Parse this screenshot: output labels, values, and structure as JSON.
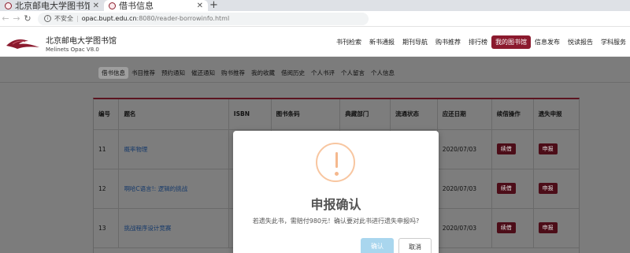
{
  "browser": {
    "tabs": [
      {
        "title": "北京邮电大学图书馆",
        "active": false
      },
      {
        "title": "借书信息",
        "active": true
      }
    ],
    "new_tab": "+",
    "security_label": "不安全",
    "url_host": "opac.bupt.edu.cn",
    "url_rest": ":8080/reader-borrowinfo.html"
  },
  "site": {
    "name_cn": "北京邮电大学图书馆",
    "name_en": "Melinets Opac V8.0",
    "brand_color": "#8b1a2e",
    "nav": [
      {
        "label": "书刊检索",
        "active": false
      },
      {
        "label": "新书通报",
        "active": false
      },
      {
        "label": "期刊导航",
        "active": false
      },
      {
        "label": "购书推荐",
        "active": false
      },
      {
        "label": "排行榜",
        "active": false
      },
      {
        "label": "我的图书馆",
        "active": true
      },
      {
        "label": "信息发布",
        "active": false
      },
      {
        "label": "悦读报告",
        "active": false
      },
      {
        "label": "学科服务",
        "active": false
      }
    ]
  },
  "subnav": [
    {
      "label": "借书信息",
      "active": true
    },
    {
      "label": "书目推荐",
      "active": false
    },
    {
      "label": "预约通知",
      "active": false
    },
    {
      "label": "催还通知",
      "active": false
    },
    {
      "label": "购书推荐",
      "active": false
    },
    {
      "label": "我的收藏",
      "active": false
    },
    {
      "label": "借阅历史",
      "active": false
    },
    {
      "label": "个人书评",
      "active": false
    },
    {
      "label": "个人留言",
      "active": false
    },
    {
      "label": "个人信息",
      "active": false
    }
  ],
  "table": {
    "headers": [
      "编号",
      "题名",
      "ISBN",
      "图书条码",
      "典藏部门",
      "流通状态",
      "应还日期",
      "续借操作",
      "遗失申报"
    ],
    "rows": [
      {
        "no": "11",
        "title": "概率物理",
        "due": "2020/07/03",
        "renew": "续借",
        "report": "申报"
      },
      {
        "no": "12",
        "title": "啊哈C语言!: 逻辑的挑战",
        "due": "2020/07/03",
        "renew": "续借",
        "report": "申报"
      },
      {
        "no": "13",
        "title": "挑战程序设计竞赛",
        "due": "2020/07/03",
        "renew": "续借",
        "report": "申报"
      }
    ]
  },
  "modal": {
    "icon": "warning-icon",
    "title": "申报确认",
    "text": "若遗失此书，需赔付980元！确认要对此书进行遗失申报吗?",
    "confirm": "确认",
    "cancel": "取消"
  }
}
